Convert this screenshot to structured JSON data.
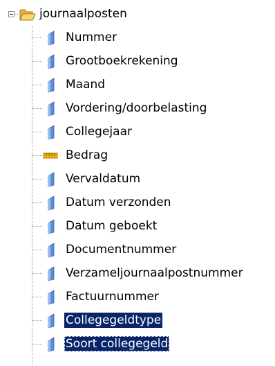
{
  "tree": {
    "root": {
      "label": "journaalposten",
      "icon": "folder-open-icon",
      "expanded": true
    },
    "items": [
      {
        "label": "Nummer",
        "icon": "field-icon",
        "selected": false
      },
      {
        "label": "Grootboekrekening",
        "icon": "field-icon",
        "selected": false
      },
      {
        "label": "Maand",
        "icon": "field-icon",
        "selected": false
      },
      {
        "label": "Vordering/doorbelasting",
        "icon": "field-icon",
        "selected": false
      },
      {
        "label": "Collegejaar",
        "icon": "field-icon",
        "selected": false
      },
      {
        "label": "Bedrag",
        "icon": "measure-icon",
        "selected": false
      },
      {
        "label": "Vervaldatum",
        "icon": "field-icon",
        "selected": false
      },
      {
        "label": "Datum verzonden",
        "icon": "field-icon",
        "selected": false
      },
      {
        "label": "Datum geboekt",
        "icon": "field-icon",
        "selected": false
      },
      {
        "label": "Documentnummer",
        "icon": "field-icon",
        "selected": false
      },
      {
        "label": "Verzameljournaalpostnummer",
        "icon": "field-icon",
        "selected": false
      },
      {
        "label": "Factuurnummer",
        "icon": "field-icon",
        "selected": false
      },
      {
        "label": "Collegegeldtype",
        "icon": "field-icon",
        "selected": true
      },
      {
        "label": "Soort collegegeld",
        "icon": "field-icon",
        "selected": true
      }
    ]
  },
  "colors": {
    "selection_bg": "#0a246a",
    "selection_fg": "#ffffff",
    "field_icon": "#5b8fd6",
    "measure_icon": "#f0b400",
    "folder": "#f5c542"
  }
}
